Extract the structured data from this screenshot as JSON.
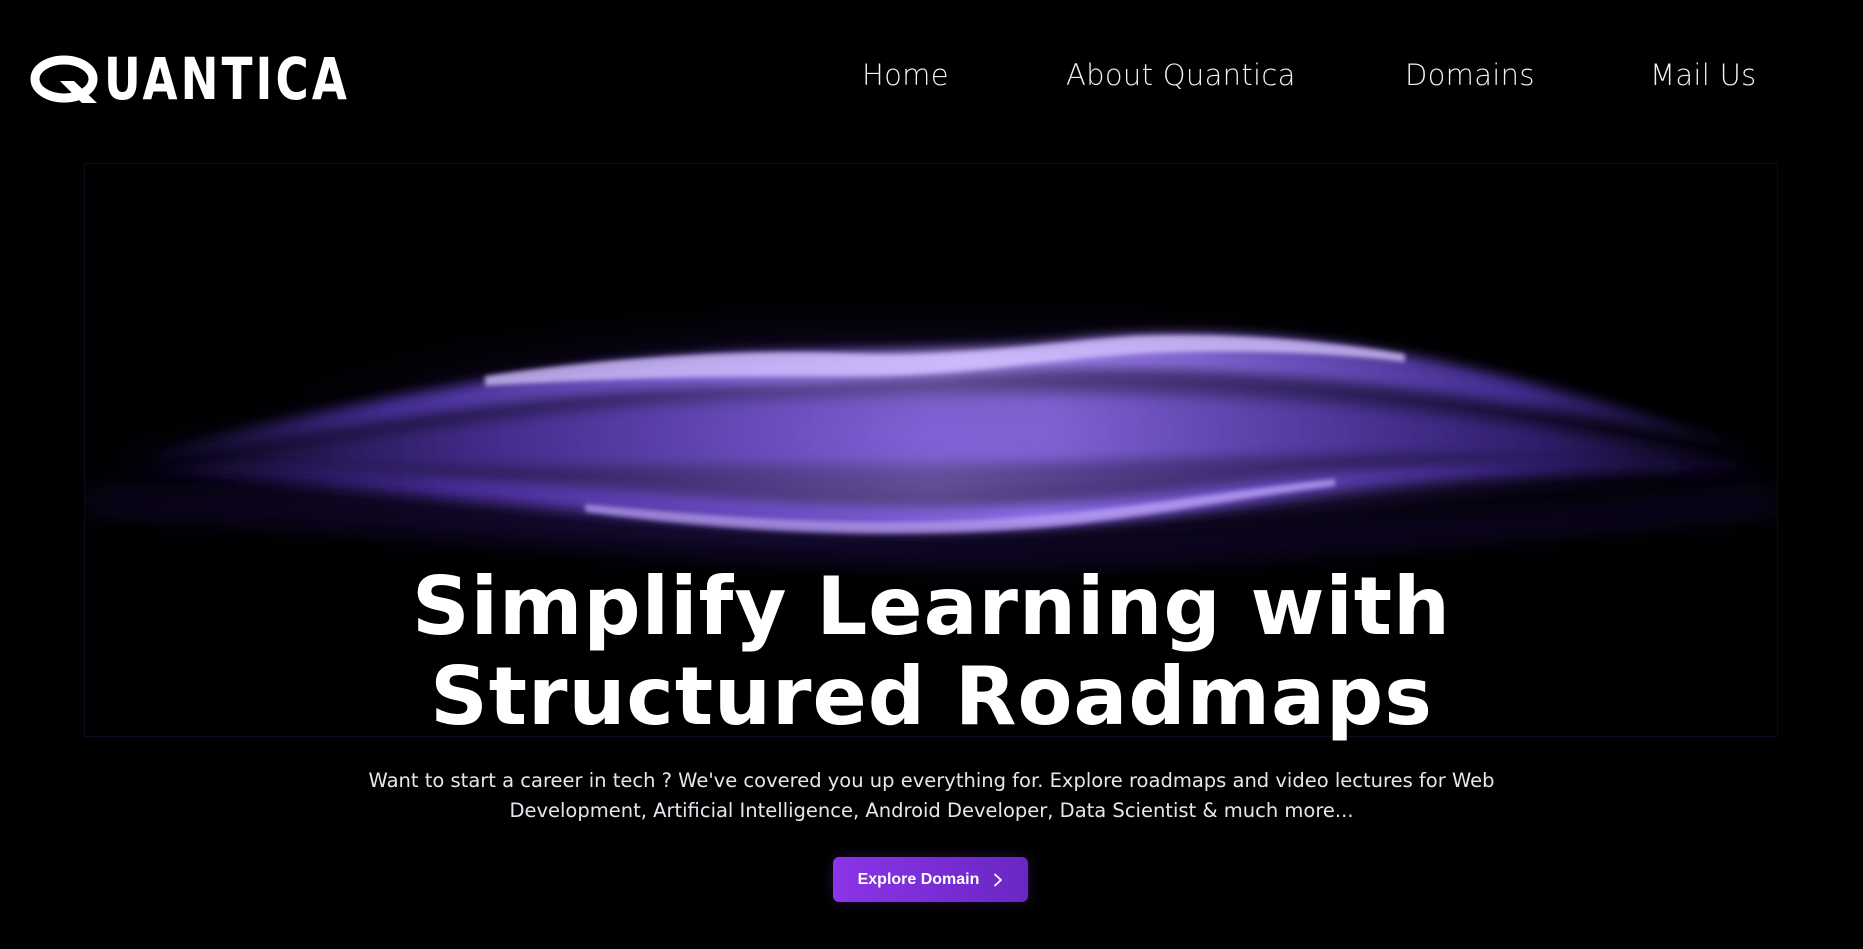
{
  "brand": {
    "logo_text": "UANTICA",
    "logo_letter": "Q"
  },
  "nav": {
    "home": "Home",
    "about": "About Quantica",
    "domains": "Domains",
    "mail": "Mail Us"
  },
  "hero": {
    "title_line1": "Simplify Learning with",
    "title_line2": "Structured Roadmaps",
    "subtitle": "Want to start a career in tech ? We've covered you up everything for. Explore roadmaps and video lectures for Web Development, Artificial Intelligence, Android Developer, Data Scientist & much more...",
    "cta_label": "Explore Domain",
    "cta_icon": "chevron-right-icon",
    "wave_icon": "purple-wave-graphic"
  },
  "colors": {
    "background": "#000000",
    "accent": "#8b34e8",
    "accent_dark": "#6a26c4",
    "wave": "#8a5cff"
  }
}
